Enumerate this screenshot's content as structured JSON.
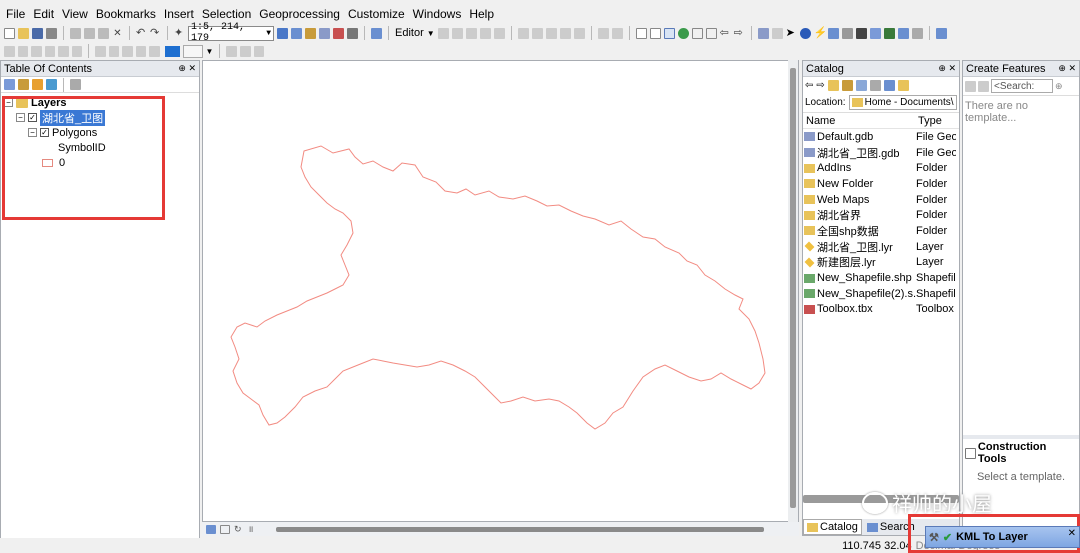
{
  "menu": [
    "File",
    "Edit",
    "View",
    "Bookmarks",
    "Insert",
    "Selection",
    "Geoprocessing",
    "Customize",
    "Windows",
    "Help"
  ],
  "toolbar": {
    "scale": "1:5, 214, 179",
    "editor_label": "Editor"
  },
  "toc": {
    "title": "Table Of Contents",
    "layers_label": "Layers",
    "layer_name": "湖北省_卫图",
    "sublayer": "Polygons",
    "field": "SymbolID",
    "value": "0"
  },
  "catalog": {
    "title": "Catalog",
    "location_label": "Location:",
    "location_value": "Home - Documents\\",
    "col_name": "Name",
    "col_type": "Type",
    "items": [
      {
        "name": "Default.gdb",
        "type": "File Geo",
        "icon": "gdb"
      },
      {
        "name": "湖北省_卫图.gdb",
        "type": "File Geo",
        "icon": "gdb"
      },
      {
        "name": "AddIns",
        "type": "Folder",
        "icon": "folder"
      },
      {
        "name": "New Folder",
        "type": "Folder",
        "icon": "folder"
      },
      {
        "name": "Web Maps",
        "type": "Folder",
        "icon": "folder"
      },
      {
        "name": "湖北省界",
        "type": "Folder",
        "icon": "folder"
      },
      {
        "name": "全国shp数据",
        "type": "Folder",
        "icon": "folder"
      },
      {
        "name": "湖北省_卫图.lyr",
        "type": "Layer",
        "icon": "layer"
      },
      {
        "name": "新建图层.lyr",
        "type": "Layer",
        "icon": "layer"
      },
      {
        "name": "New_Shapefile.shp",
        "type": "Shapefil",
        "icon": "shp"
      },
      {
        "name": "New_Shapefile(2).s...",
        "type": "Shapefil",
        "icon": "shp"
      },
      {
        "name": "Toolbox.tbx",
        "type": "Toolbox",
        "icon": "toolbox"
      }
    ],
    "tab_catalog": "Catalog",
    "tab_search": "Search"
  },
  "create_features": {
    "title": "Create Features",
    "search_placeholder": "<Search:",
    "empty_msg": "There are no template...",
    "construction_title": "Construction Tools",
    "construction_msg": "Select a template."
  },
  "status": {
    "coords": "110.745  32.04",
    "units": "Decimal Degrees"
  },
  "notification": {
    "text": "KML To Layer"
  },
  "watermark": "祥帅的小屋"
}
